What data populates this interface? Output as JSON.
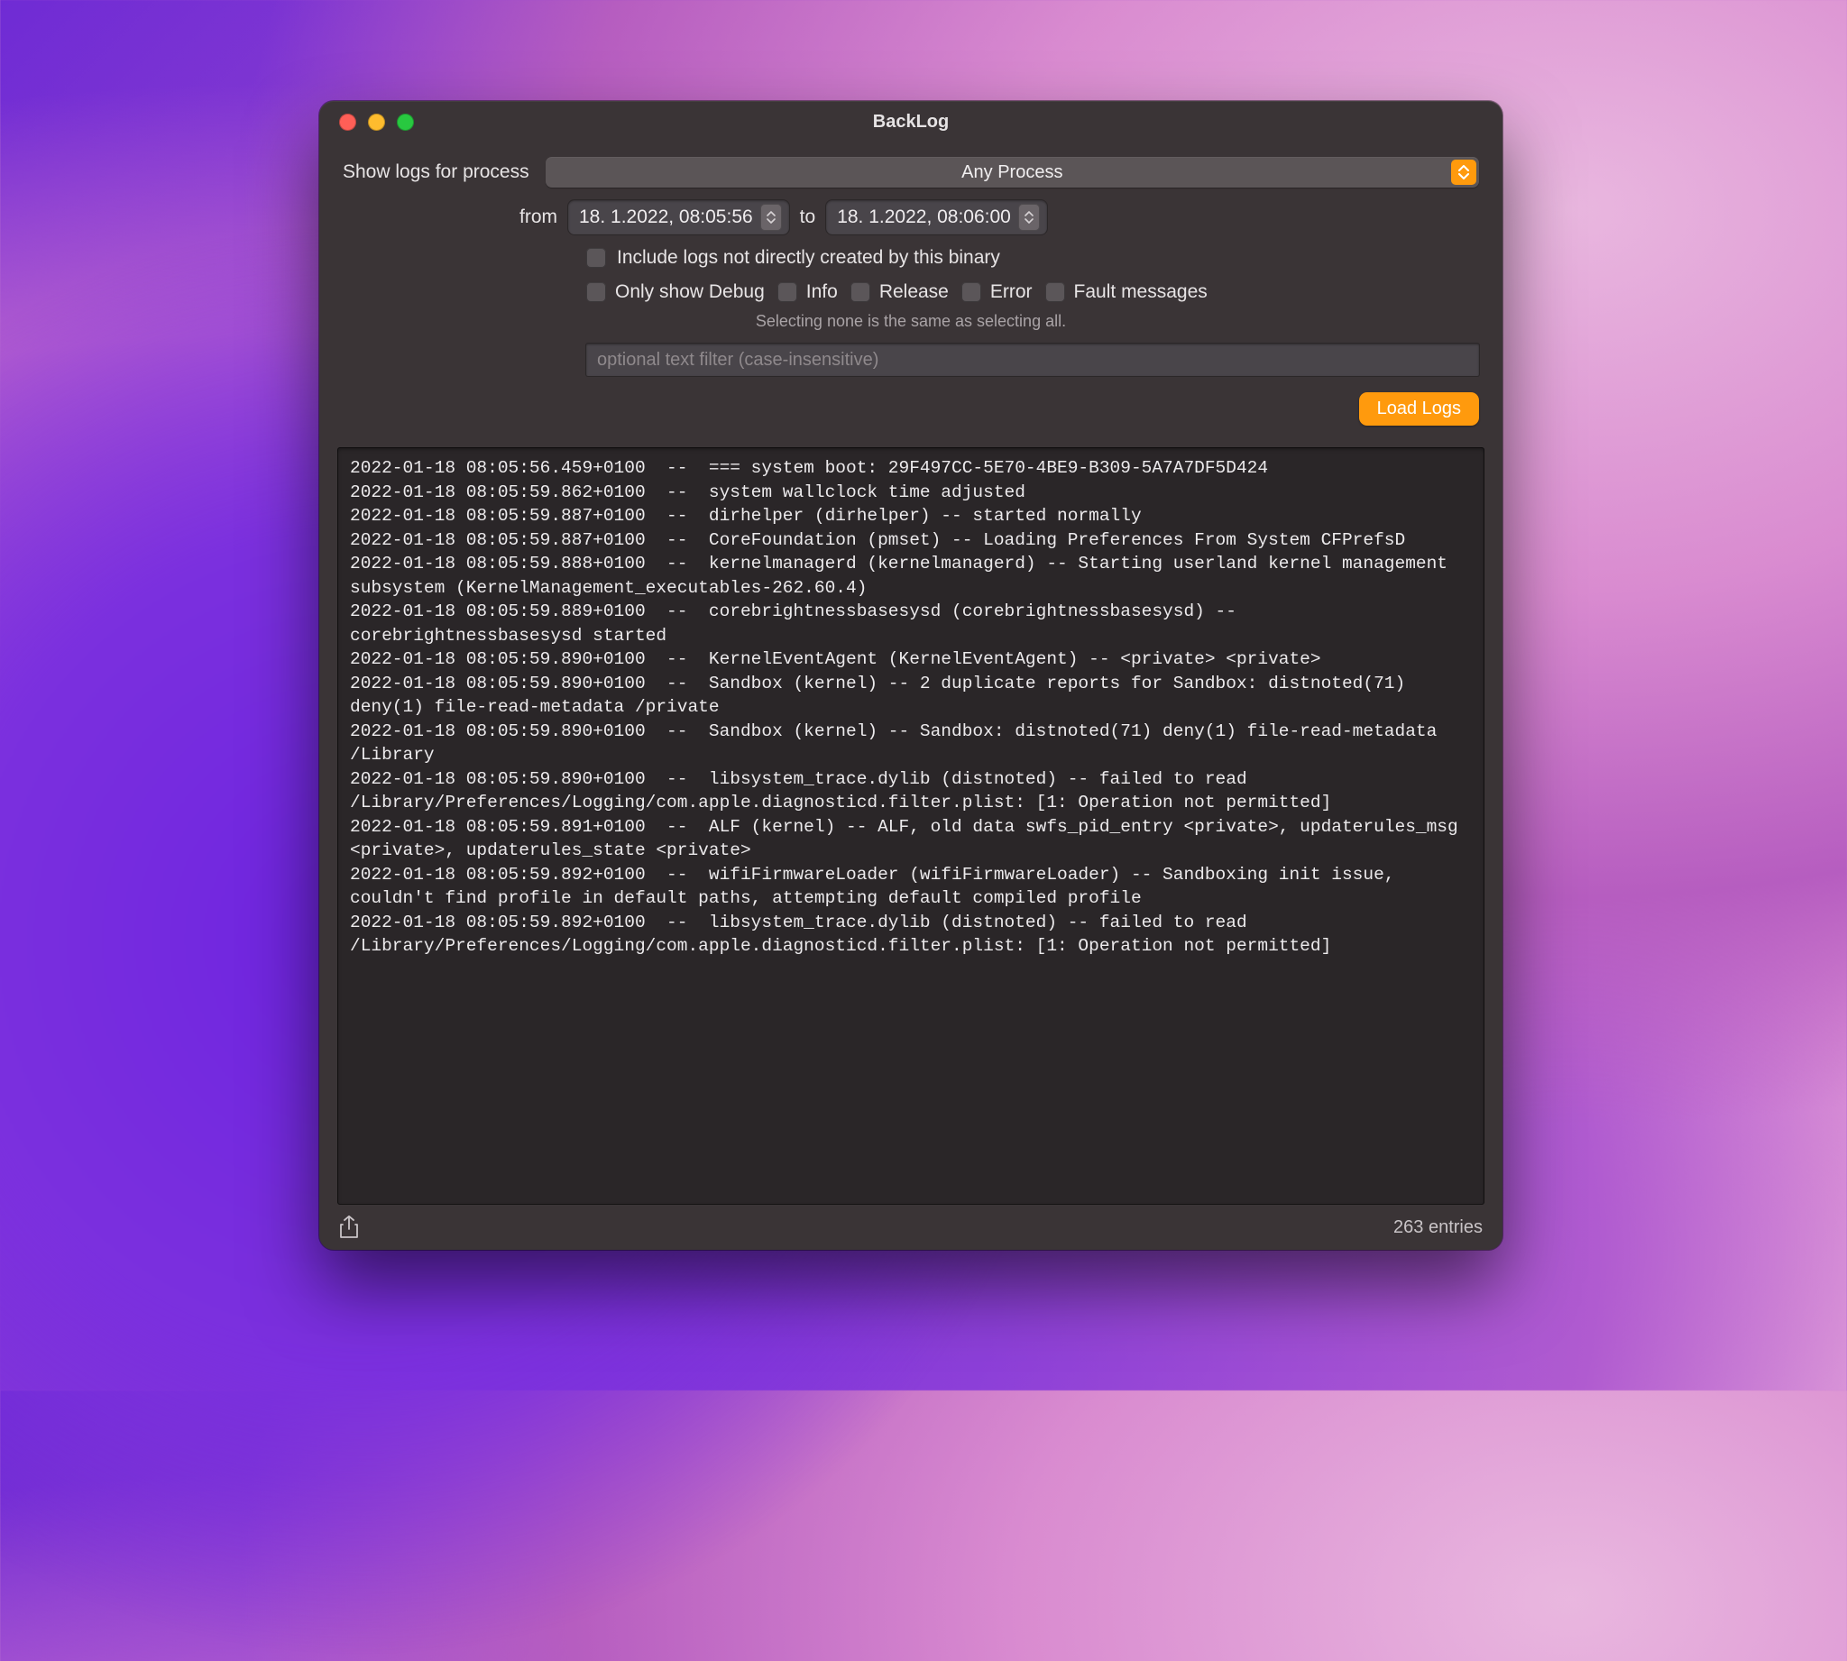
{
  "window": {
    "title": "BackLog"
  },
  "accent": "#ff9a0d",
  "processRow": {
    "label": "Show logs for process",
    "selected": "Any Process"
  },
  "dateRow": {
    "fromLabel": "from",
    "toLabel": "to",
    "fromValue": "18.  1.2022, 08:05:56",
    "toValue": "18.  1.2022, 08:06:00"
  },
  "includeRow": {
    "label": "Include logs not directly created by this binary"
  },
  "levels": {
    "prefix": "Only show",
    "items": [
      "Debug",
      "Info",
      "Release",
      "Error",
      "Fault messages"
    ]
  },
  "hint": "Selecting none is the same as selecting all.",
  "filter": {
    "placeholder": "optional text filter (case-insensitive)",
    "value": ""
  },
  "loadButton": "Load Logs",
  "footer": {
    "entries": "263 entries"
  },
  "log_lines": [
    "2022-01-18 08:05:56.459+0100  --  === system boot: 29F497CC-5E70-4BE9-B309-5A7A7DF5D424",
    "2022-01-18 08:05:59.862+0100  --  system wallclock time adjusted",
    "2022-01-18 08:05:59.887+0100  --  dirhelper (dirhelper) -- started normally",
    "2022-01-18 08:05:59.887+0100  --  CoreFoundation (pmset) -- Loading Preferences From System CFPrefsD",
    "2022-01-18 08:05:59.888+0100  --  kernelmanagerd (kernelmanagerd) -- Starting userland kernel management subsystem (KernelManagement_executables-262.60.4)",
    "2022-01-18 08:05:59.889+0100  --  corebrightnessbasesysd (corebrightnessbasesysd) -- corebrightnessbasesysd started",
    "2022-01-18 08:05:59.890+0100  --  KernelEventAgent (KernelEventAgent) -- <private> <private>",
    "2022-01-18 08:05:59.890+0100  --  Sandbox (kernel) -- 2 duplicate reports for Sandbox: distnoted(71) deny(1) file-read-metadata /private",
    "2022-01-18 08:05:59.890+0100  --  Sandbox (kernel) -- Sandbox: distnoted(71) deny(1) file-read-metadata /Library",
    "2022-01-18 08:05:59.890+0100  --  libsystem_trace.dylib (distnoted) -- failed to read /Library/Preferences/Logging/com.apple.diagnosticd.filter.plist: [1: Operation not permitted]",
    "2022-01-18 08:05:59.891+0100  --  ALF (kernel) -- ALF, old data swfs_pid_entry <private>, updaterules_msg <private>, updaterules_state <private>",
    "2022-01-18 08:05:59.892+0100  --  wifiFirmwareLoader (wifiFirmwareLoader) -- Sandboxing init issue, couldn't find profile in default paths, attempting default compiled profile",
    "2022-01-18 08:05:59.892+0100  --  libsystem_trace.dylib (distnoted) -- failed to read /Library/Preferences/Logging/com.apple.diagnosticd.filter.plist: [1: Operation not permitted]"
  ]
}
